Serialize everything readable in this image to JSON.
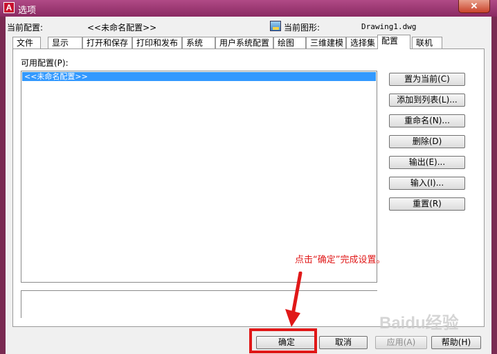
{
  "window": {
    "title": "选项",
    "close_glyph": "✕"
  },
  "header": {
    "current_profile_label": "当前配置:",
    "current_profile_value": "<<未命名配置>>",
    "current_drawing_label": "当前图形:",
    "current_drawing_value": "Drawing1.dwg"
  },
  "tabs": [
    "文件",
    "显示",
    "打开和保存",
    "打印和发布",
    "系统",
    "用户系统配置",
    "绘图",
    "三维建模",
    "选择集",
    "配置",
    "联机"
  ],
  "active_tab": "配置",
  "profiles": {
    "label": "可用配置(P):",
    "items": [
      "<<未命名配置>>"
    ],
    "selected_index": 0
  },
  "side_buttons": {
    "set_current": "置为当前(C)",
    "add_to_list": "添加到列表(L)...",
    "rename": "重命名(N)...",
    "delete": "删除(D)",
    "export": "输出(E)...",
    "import": "输入(I)...",
    "reset": "重置(R)"
  },
  "footer_buttons": {
    "ok": "确定",
    "cancel": "取消",
    "apply": "应用(A)",
    "help": "帮助(H)"
  },
  "annotation": {
    "text": "点击“确定”完成设置。",
    "color": "#e01818"
  },
  "watermark": "Baidu经验",
  "colors": {
    "titlebar": "#a03c76",
    "selection": "#3399ff",
    "annotation": "#e01818"
  }
}
